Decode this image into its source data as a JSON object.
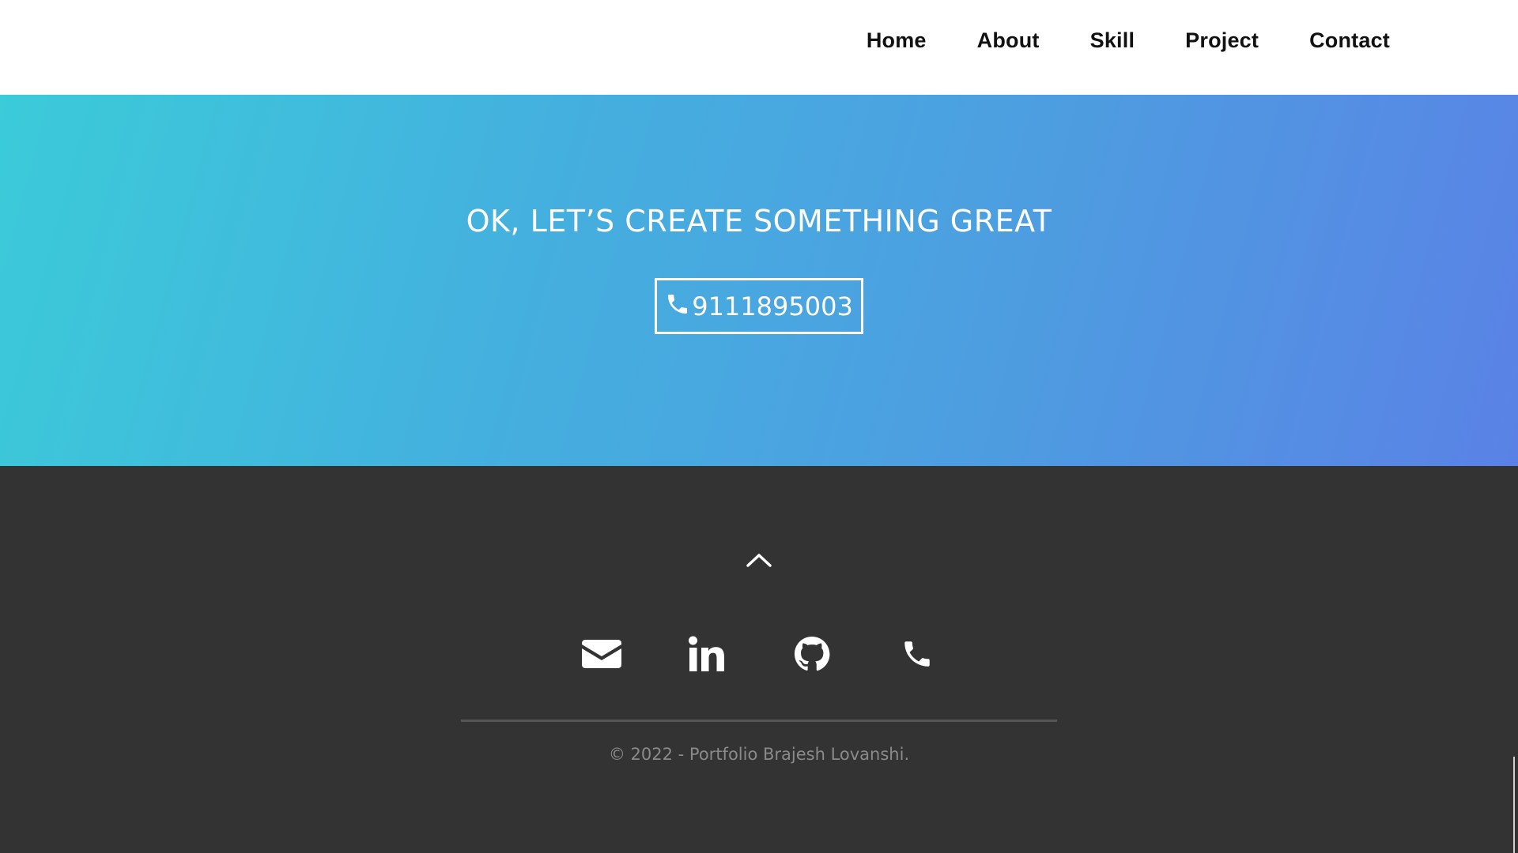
{
  "nav": {
    "items": [
      {
        "label": "Home"
      },
      {
        "label": "About"
      },
      {
        "label": "Skill"
      },
      {
        "label": "Project"
      },
      {
        "label": "Contact"
      }
    ]
  },
  "hero": {
    "title": "OK, LET’S CREATE SOMETHING GREAT",
    "phone_label": "9111895003",
    "phone_icon": "phone-icon",
    "gradient": [
      "#3bcbd9",
      "#5a82e6"
    ]
  },
  "footer": {
    "scroll_top_icon": "chevron-up-icon",
    "social": [
      {
        "icon": "envelope-icon"
      },
      {
        "icon": "linkedin-icon"
      },
      {
        "icon": "github-icon"
      },
      {
        "icon": "phone-icon"
      }
    ],
    "copyright": "© 2022 - Portfolio Brajesh Lovanshi.",
    "background": "#333333"
  }
}
